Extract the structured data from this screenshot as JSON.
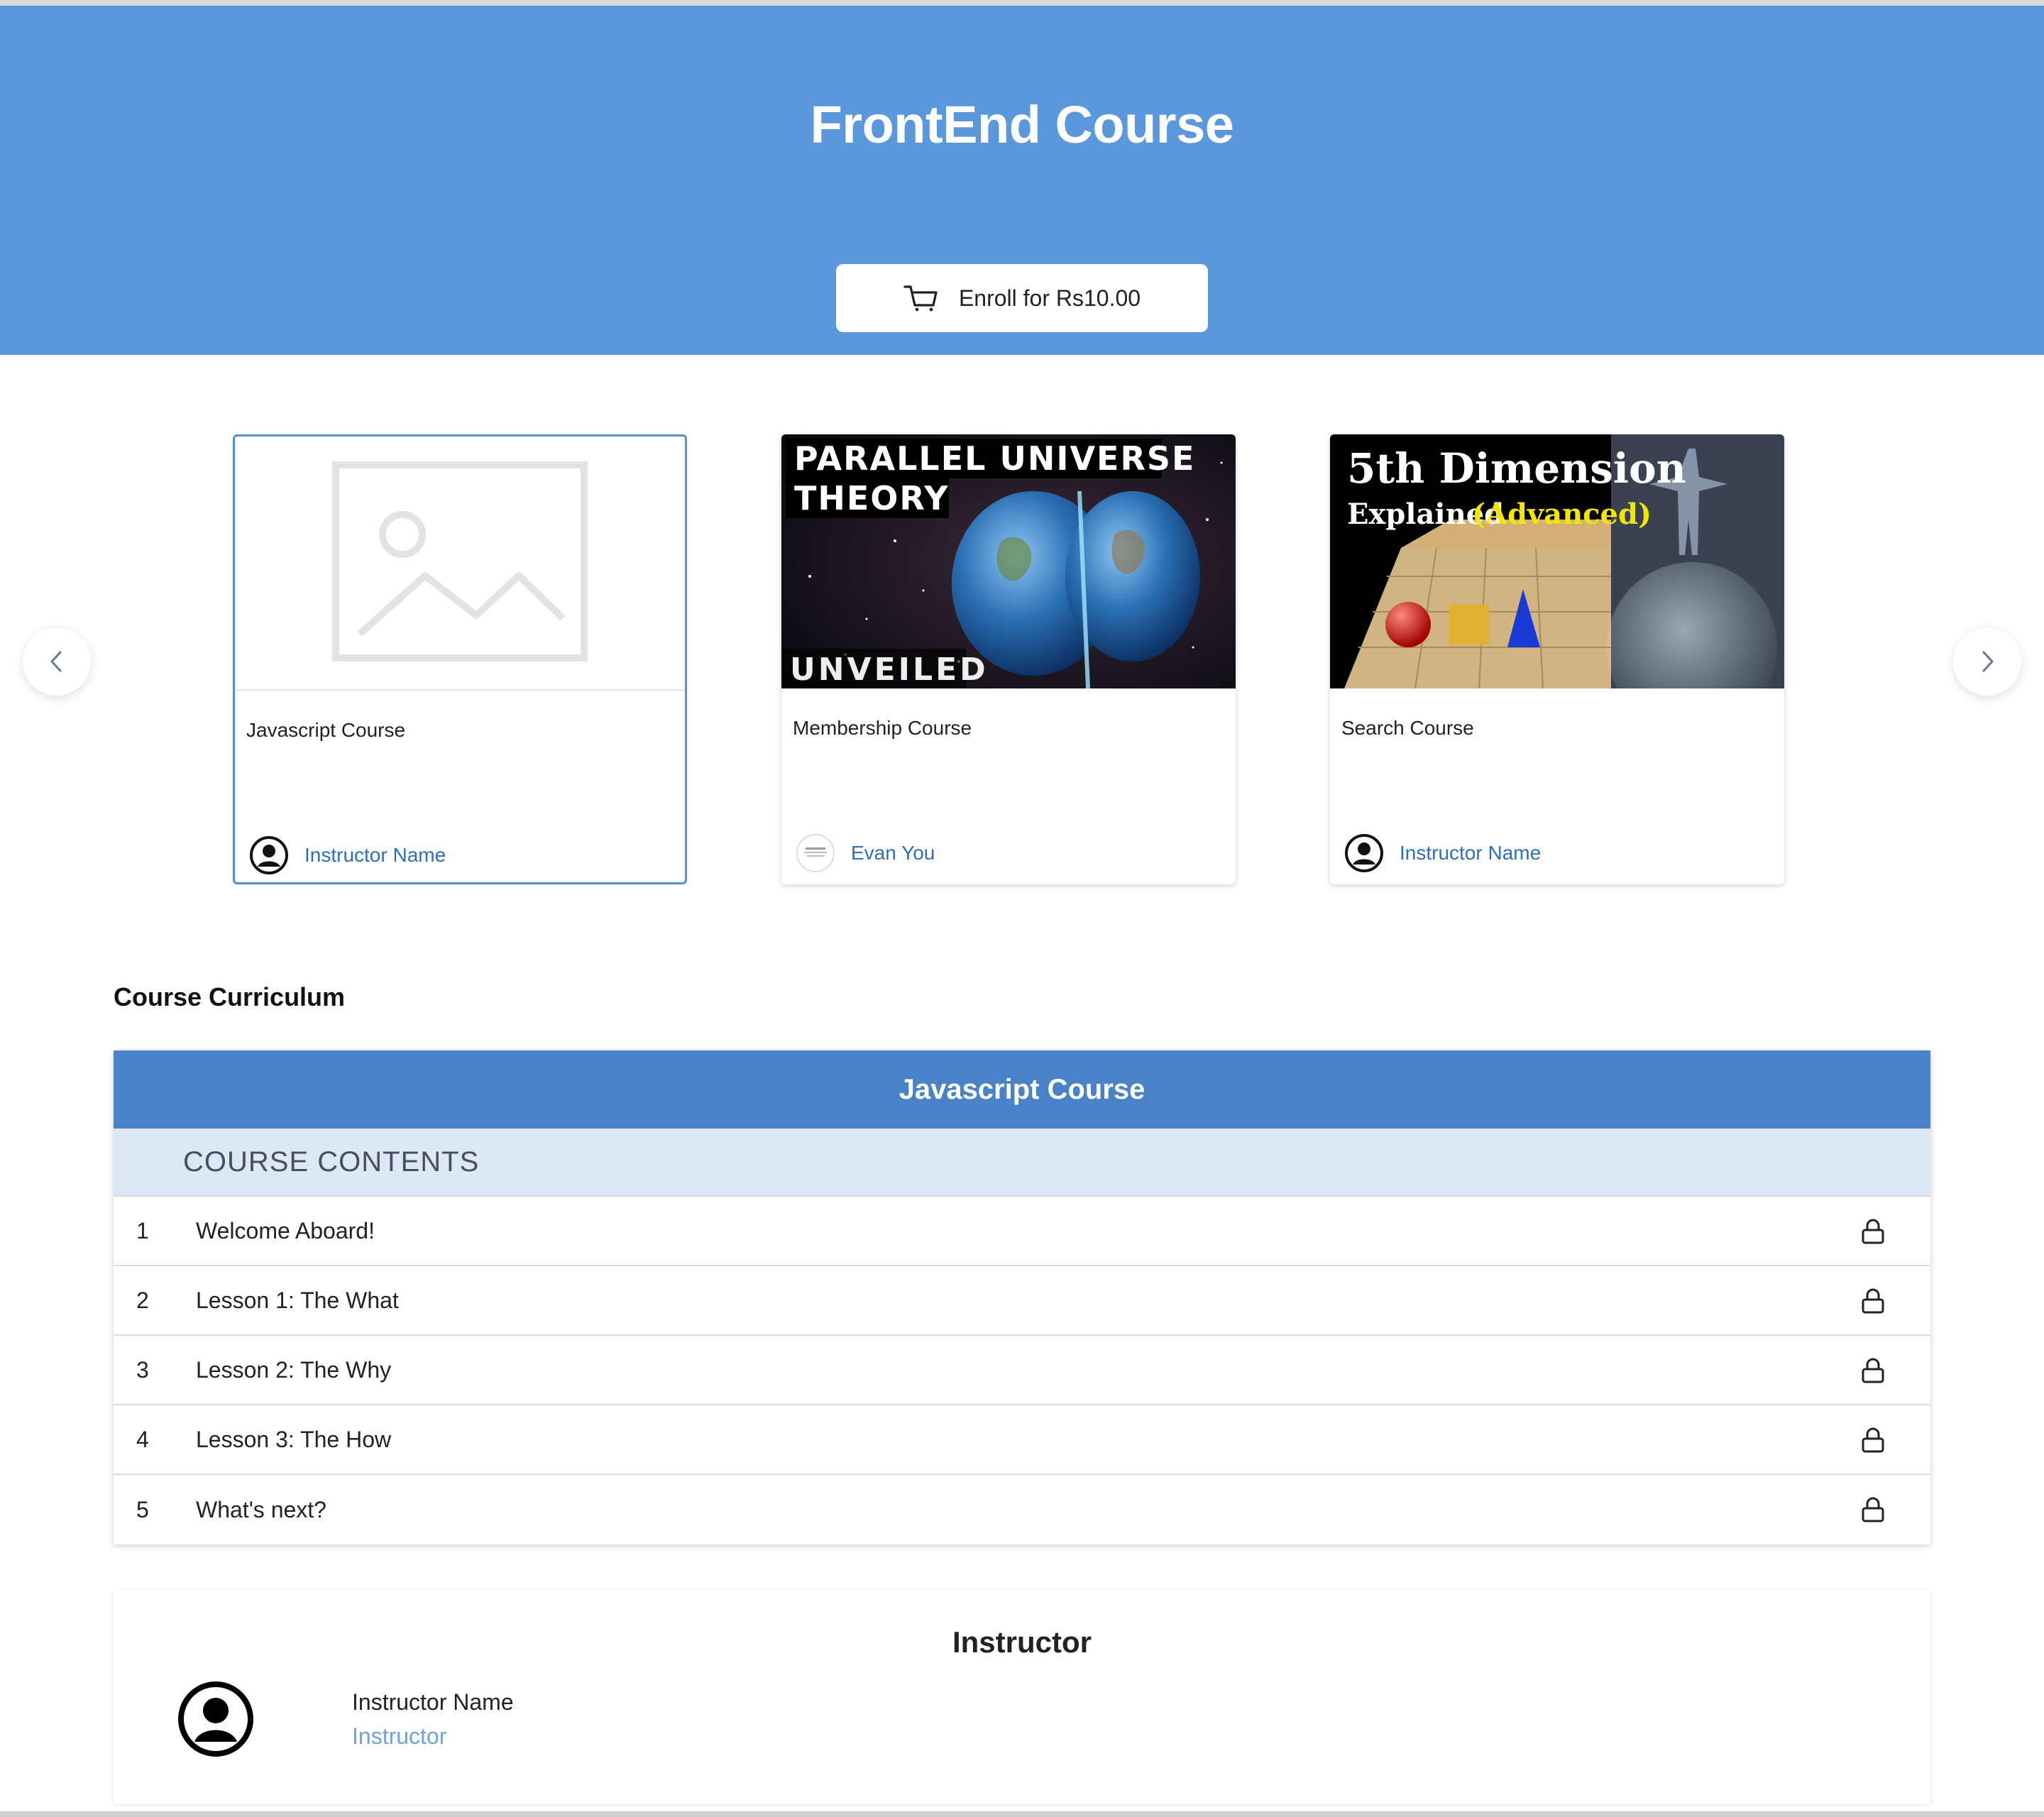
{
  "hero": {
    "title": "FrontEnd Course",
    "enroll_label": "Enroll for Rs10.00"
  },
  "carousel": {
    "cards": [
      {
        "title": "Javascript Course",
        "instructor": "Instructor Name",
        "thumb": "image-placeholder-icon"
      },
      {
        "title": "Membership Course",
        "instructor": "Evan You",
        "thumb_text": [
          "PARALLEL UNIVERSE",
          "THEORY",
          "UNVEILED"
        ]
      },
      {
        "title": "Search Course",
        "instructor": "Instructor Name",
        "thumb_text": [
          "5th Dimension",
          "Explained",
          "(Advanced)"
        ]
      }
    ]
  },
  "curriculum": {
    "section_title": "Course Curriculum",
    "course_title": "Javascript Course",
    "contents_label": "COURSE CONTENTS",
    "lessons": [
      {
        "num": "1",
        "title": "Welcome Aboard!"
      },
      {
        "num": "2",
        "title": "Lesson 1: The What"
      },
      {
        "num": "3",
        "title": "Lesson 2: The Why"
      },
      {
        "num": "4",
        "title": "Lesson 3: The How"
      },
      {
        "num": "5",
        "title": "What's next?"
      }
    ]
  },
  "instructor": {
    "heading": "Instructor",
    "name": "Instructor Name",
    "role": "Instructor"
  },
  "colors": {
    "hero": "#5a98db",
    "curriculum_header": "#4a82c8",
    "contents_bg": "#dce8f8",
    "link": "#2f6fb8"
  }
}
